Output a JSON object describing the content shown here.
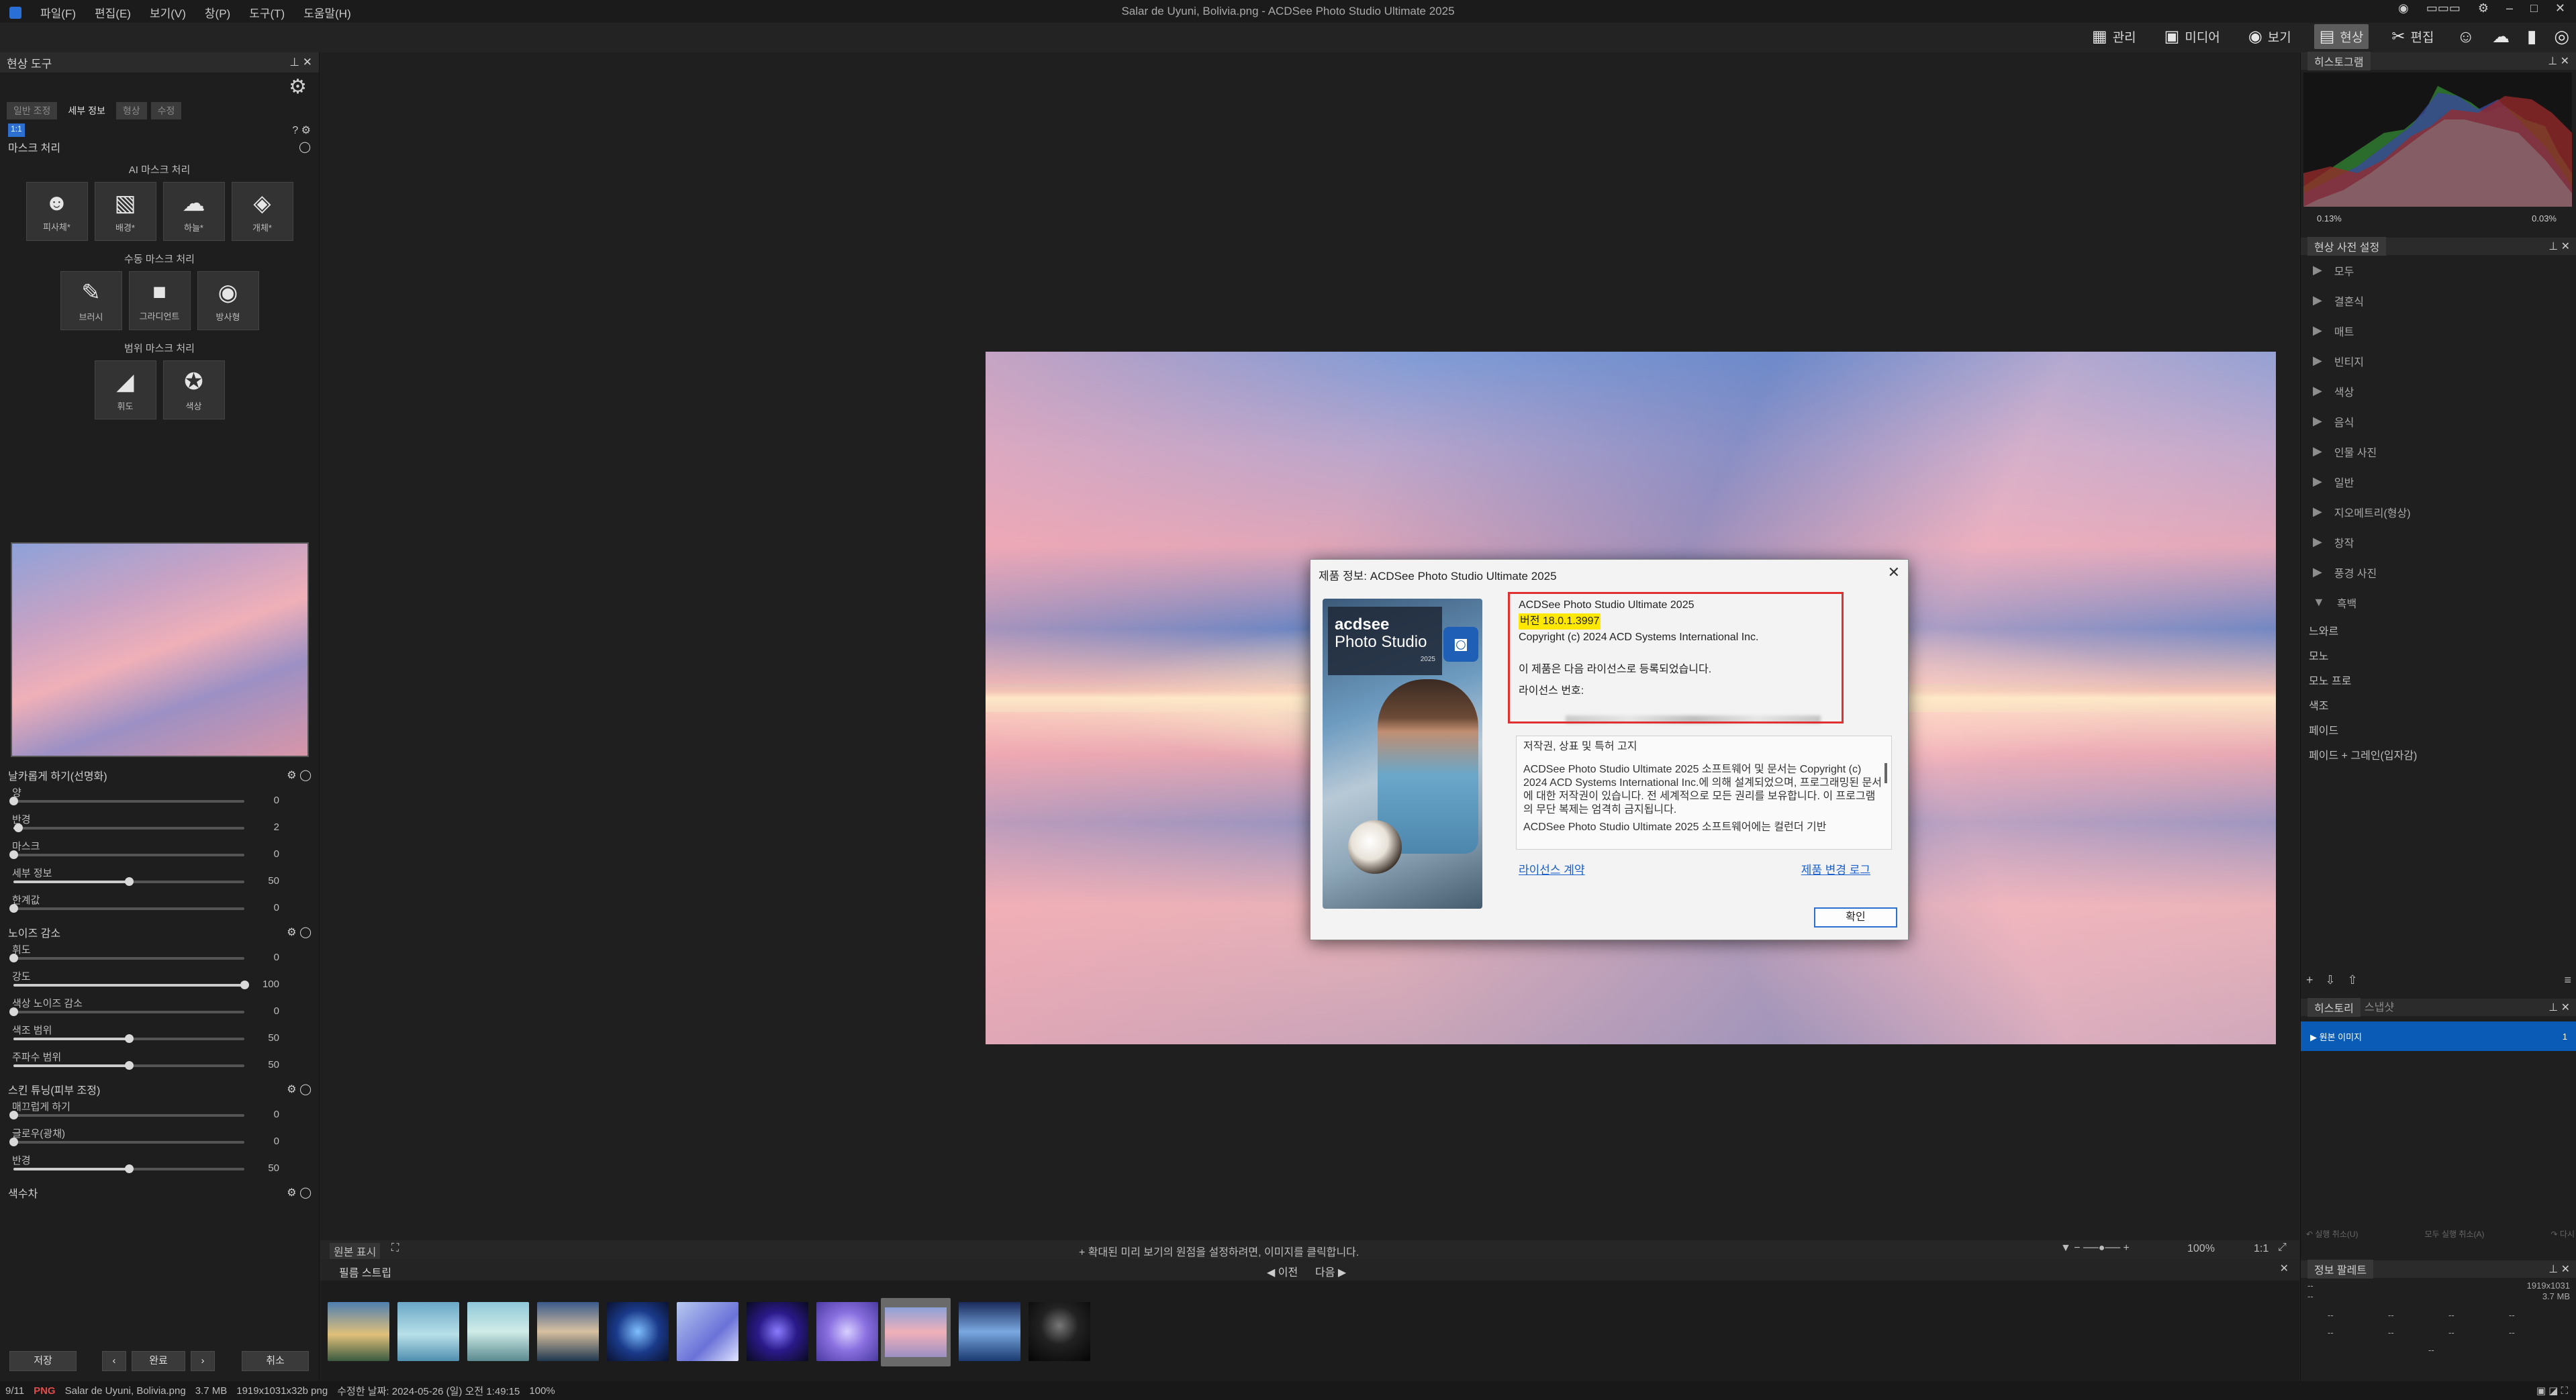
{
  "titlebar": {
    "title": "Salar de Uyuni, Bolivia.png - ACDSee Photo Studio Ultimate 2025",
    "menu": [
      "파일(F)",
      "편집(E)",
      "보기(V)",
      "창(P)",
      "도구(T)",
      "도움말(H)"
    ],
    "win_minimize": "–",
    "win_maximize": "□",
    "win_close": "✕"
  },
  "modes": [
    {
      "label": "관리",
      "icon": "grid-icon"
    },
    {
      "label": "미디어",
      "icon": "media-icon"
    },
    {
      "label": "보기",
      "icon": "eye-icon"
    },
    {
      "label": "현상",
      "icon": "develop-icon",
      "active": true
    },
    {
      "label": "편집",
      "icon": "edit-icon"
    }
  ],
  "left": {
    "panel_title": "현상 도구",
    "tabs": [
      "일반 조정",
      "세부 정보",
      "형상",
      "수정"
    ],
    "active_tab": "세부 정보",
    "zoom_tag": "1:1",
    "masking": {
      "title": "마스크 처리",
      "ai_title": "AI 마스크 처리",
      "ai_tools": [
        "피사체*",
        "배경*",
        "하늘*",
        "개체*"
      ],
      "manual_title": "수동 마스크 처리",
      "manual_tools": [
        "브러시",
        "그라디언트",
        "방사형"
      ],
      "range_title": "범위 마스크 처리",
      "range_tools": [
        "휘도",
        "색상"
      ]
    },
    "sharpen": {
      "title": "날카롭게 하기(선명화)",
      "sliders": [
        {
          "label": "양",
          "value": 0,
          "pct": 0
        },
        {
          "label": "반경",
          "value": 2,
          "pct": 2
        },
        {
          "label": "마스크",
          "value": 0,
          "pct": 0
        },
        {
          "label": "세부 정보",
          "value": 50,
          "pct": 50
        },
        {
          "label": "한계값",
          "value": 0,
          "pct": 0
        }
      ]
    },
    "noise": {
      "title": "노이즈 감소",
      "sliders": [
        {
          "label": "휘도",
          "value": 0,
          "pct": 0
        },
        {
          "label": "강도",
          "value": 100,
          "pct": 100
        },
        {
          "label": "색상 노이즈 감소",
          "value": 0,
          "pct": 0
        },
        {
          "label": "색조 범위",
          "value": 50,
          "pct": 50
        },
        {
          "label": "주파수 범위",
          "value": 50,
          "pct": 50
        }
      ]
    },
    "skin": {
      "title": "스킨 튜닝(피부 조정)",
      "sliders": [
        {
          "label": "매끄럽게 하기",
          "value": 0,
          "pct": 0
        },
        {
          "label": "글로우(광채)",
          "value": 0,
          "pct": 0
        },
        {
          "label": "반경",
          "value": 50,
          "pct": 50
        }
      ]
    },
    "color_section": "색수차",
    "buttons": {
      "save": "저장",
      "done": "완료",
      "cancel": "취소"
    }
  },
  "center": {
    "show_original": "원본 표시",
    "hint": "+ 확대된 미리 보기의 원점을 설정하려면, 이미지를 클릭합니다.",
    "zoom": "100%",
    "ratio": "1:1"
  },
  "dialog": {
    "title": "제품 정보: ACDSee Photo Studio Ultimate 2025",
    "product": "ACDSee Photo Studio Ultimate 2025",
    "version": "버전 18.0.1.3997",
    "copyright": "Copyright (c) 2024 ACD Systems International Inc.",
    "registered": "이 제품은 다음 라이선스로 등록되었습니다.",
    "license_label": "라이선스 번호:",
    "legal_heading": "저작권, 상표 및 특허 고지",
    "legal_body": "ACDSee Photo Studio Ultimate 2025 소프트웨어 및 문서는 Copyright (c) 2024 ACD Systems International Inc.에 의해 설계되었으며, 프로그래밍된 문서에 대한 저작권이 있습니다. 전 세계적으로 모든 권리를 보유합니다. 이 프로그램의 무단 복제는 엄격히 금지됩니다.",
    "legal_more": "ACDSee Photo Studio Ultimate 2025 소프트웨어에는 컬런더 기반",
    "link_license": "라이선스 계약",
    "link_changelog": "제품 변경 로그",
    "ok": "확인",
    "logo_line1": "acdsee",
    "logo_line2": "Photo Studio",
    "logo_line3": "2025"
  },
  "right": {
    "histogram_title": "히스토그램",
    "histogram_left": "0.13%",
    "histogram_right": "0.03%",
    "presets_title": "현상 사전 설정",
    "presets": [
      "모두",
      "결혼식",
      "매트",
      "빈티지",
      "색상",
      "음식",
      "인물 사진",
      "일반",
      "지오메트리(형상)",
      "창작",
      "풍경 사진",
      "흑백"
    ],
    "bw_items": [
      "느와르",
      "모노",
      "모노 프로",
      "색조",
      "페이드",
      "페이드 + 그레인(입자감)"
    ],
    "history_tabs": [
      "히스토리",
      "스냅샷"
    ],
    "history_item": "원본 이미지",
    "history_count": "1",
    "undo": "실행 취소(U)",
    "undo_all": "모두 실행 취소(A)",
    "redo": "다시",
    "info_title": "정보 팔레트",
    "info_size": "1919x1031",
    "info_filesize": "3.7 MB",
    "info_dashes": "--"
  },
  "film": {
    "title": "필름 스트립",
    "prev": "이전",
    "next": "다음"
  },
  "status": {
    "count": "9/11",
    "type": "PNG",
    "filename": "Salar de Uyuni, Bolivia.png",
    "size": "3.7 MB",
    "dims": "1919x1031x32b png",
    "modified": "수정한 날짜: 2024-05-26 (일) 오전 1:49:15",
    "zoom": "100%"
  },
  "colors": {
    "accent": "#0a5bb5",
    "highlight": "#ffe800",
    "redbox": "#e03131",
    "link": "#1a5fcc"
  }
}
